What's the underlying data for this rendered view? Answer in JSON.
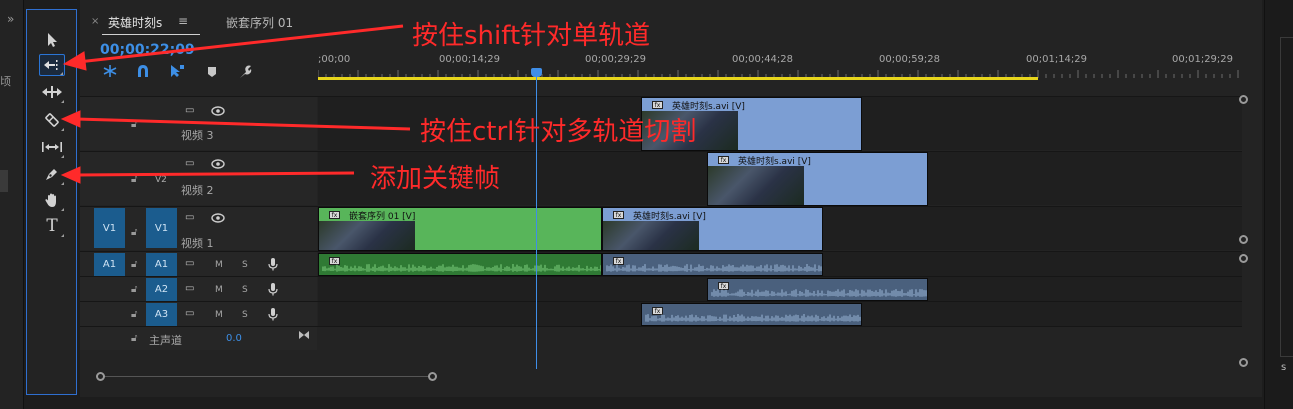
{
  "left_strip": {
    "collapse_glyph": "»",
    "fragment_text": "顷"
  },
  "tools": [
    {
      "name": "selection-tool",
      "icon": "arrow-icon"
    },
    {
      "name": "track-select-forward-tool",
      "icon": "track-select-icon",
      "selected": true
    },
    {
      "name": "ripple-edit-tool",
      "icon": "ripple-edit-icon"
    },
    {
      "name": "razor-tool",
      "icon": "razor-icon"
    },
    {
      "name": "slip-tool",
      "icon": "slip-icon"
    },
    {
      "name": "pen-tool",
      "icon": "pen-icon"
    },
    {
      "name": "hand-tool",
      "icon": "hand-icon"
    },
    {
      "name": "type-tool",
      "icon": "type-icon",
      "glyph": "T"
    }
  ],
  "timeline": {
    "tabs": [
      {
        "label": "英雄时刻s",
        "close": "×",
        "menu": "≡",
        "active": true
      },
      {
        "label": "嵌套序列 01",
        "active": false
      }
    ],
    "timecode": "00;00;22;09",
    "ruler_labels": [
      ";00;00",
      "00;00;14;29",
      "00;00;29;29",
      "00;00;44;28",
      "00;00;59;28",
      "00;01;14;29",
      "00;01;29;29"
    ],
    "tracks": {
      "video": [
        {
          "id": "V3",
          "name": "视频 3"
        },
        {
          "id": "V2",
          "name": "视频 2"
        },
        {
          "id": "V1",
          "name": "视频 1",
          "source": "V1"
        }
      ],
      "audio": [
        {
          "id": "A1",
          "source": "A1"
        },
        {
          "id": "A2"
        },
        {
          "id": "A3"
        }
      ],
      "mute": "M",
      "solo": "S"
    },
    "master": {
      "label": "主声道",
      "value": "0.0"
    },
    "clips": {
      "v3": "英雄时刻s.avi [V]",
      "v2": "英雄时刻s.avi [V]",
      "v1_green": "嵌套序列 01 [V]",
      "v1_blue": "英雄时刻s.avi [V]"
    },
    "fx": "fx"
  },
  "annotations": {
    "shift": "按住shift针对单轨道",
    "ctrl": "按住ctrl针对多轨道切割",
    "keyframe": "添加关键帧"
  },
  "right_panel": {
    "fragment": "s"
  },
  "colors": {
    "annotation_red": "#ff2a2a",
    "track_blue": "#1b5c8e",
    "clip_blue": "#7c9ed3",
    "clip_green": "#58b55a",
    "playhead_blue": "#3f8ee8",
    "work_area_yellow": "#e7d51c"
  }
}
